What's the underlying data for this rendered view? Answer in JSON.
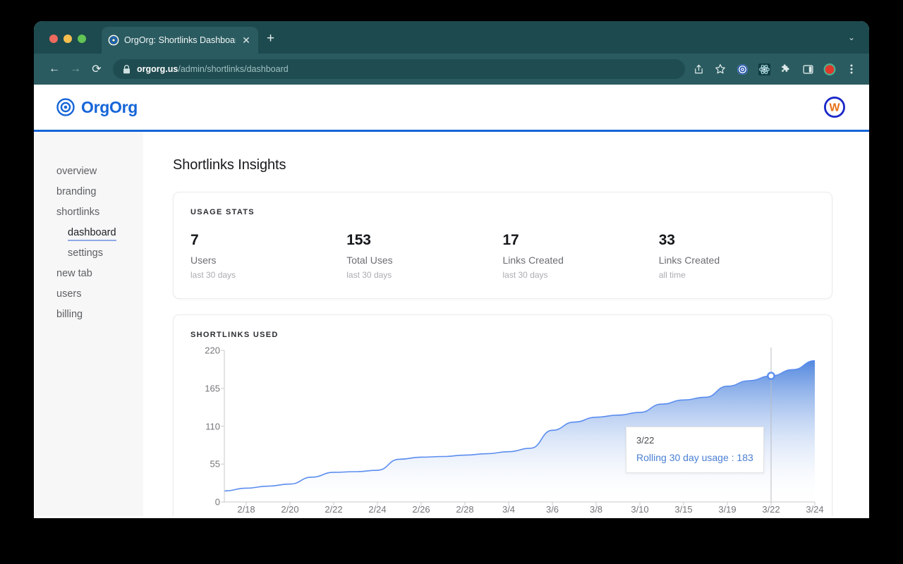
{
  "browser": {
    "tab": {
      "title": "OrgOrg: Shortlinks Dashboard",
      "favicon": "target-icon",
      "close": "✕"
    },
    "new_tab": "+",
    "window_chevron": "⌄",
    "nav": {
      "back": "←",
      "forward": "→",
      "reload": "⟳"
    },
    "omnibox": {
      "domain": "orgorg.us",
      "path": "/admin/shortlinks/dashboard",
      "lock": "lock-icon"
    },
    "actions": [
      "share-icon",
      "bookmark-star-icon",
      "target-extension-icon",
      "atom-extension-icon",
      "puzzle-extension-icon",
      "side-panel-icon",
      "profile-avatar-icon",
      "three-dot-menu-icon"
    ]
  },
  "app": {
    "brand": {
      "name": "OrgOrg",
      "mark": "target-logo-icon"
    },
    "avatar_letter": "W"
  },
  "sidebar": {
    "items": [
      {
        "label": "overview",
        "sub": false,
        "active": false
      },
      {
        "label": "branding",
        "sub": false,
        "active": false
      },
      {
        "label": "shortlinks",
        "sub": false,
        "active": false
      },
      {
        "label": "dashboard",
        "sub": true,
        "active": true
      },
      {
        "label": "settings",
        "sub": true,
        "active": false
      },
      {
        "label": "new tab",
        "sub": false,
        "active": false
      },
      {
        "label": "users",
        "sub": false,
        "active": false
      },
      {
        "label": "billing",
        "sub": false,
        "active": false
      }
    ]
  },
  "main": {
    "page_title": "Shortlinks Insights",
    "stats_card": {
      "label": "USAGE STATS",
      "stats": [
        {
          "value": "7",
          "name": "Users",
          "period": "last 30 days"
        },
        {
          "value": "153",
          "name": "Total Uses",
          "period": "last 30 days"
        },
        {
          "value": "17",
          "name": "Links Created",
          "period": "last 30 days"
        },
        {
          "value": "33",
          "name": "Links Created",
          "period": "all time"
        }
      ]
    },
    "chart_card": {
      "label": "SHORTLINKS USED",
      "tooltip": {
        "date": "3/22",
        "value": "Rolling 30 day usage : 183"
      }
    }
  },
  "chart_data": {
    "type": "area",
    "title": "SHORTLINKS USED",
    "xlabel": "",
    "ylabel": "",
    "ylim": [
      0,
      220
    ],
    "yticks": [
      0,
      55,
      110,
      165,
      220
    ],
    "grid": false,
    "legend": false,
    "series_name": "Rolling 30 day usage",
    "line_color": "#5b8def",
    "fill_gradient": [
      "#4a82dd",
      "#ffffff"
    ],
    "hover": {
      "x": "3/22",
      "y": 183
    },
    "categories": [
      "2/18",
      "2/20",
      "2/22",
      "2/24",
      "2/26",
      "2/28",
      "3/4",
      "3/6",
      "3/8",
      "3/10",
      "3/15",
      "3/19",
      "3/22",
      "3/24"
    ],
    "x": [
      "2/17",
      "2/18",
      "2/19",
      "2/20",
      "2/21",
      "2/22",
      "2/23",
      "2/24",
      "2/25",
      "2/26",
      "2/27",
      "2/28",
      "3/3",
      "3/4",
      "3/5",
      "3/6",
      "3/7",
      "3/8",
      "3/9",
      "3/10",
      "3/14",
      "3/15",
      "3/18",
      "3/19",
      "3/21",
      "3/22",
      "3/23",
      "3/24"
    ],
    "values": [
      16,
      20,
      23,
      26,
      36,
      43,
      44,
      46,
      62,
      65,
      66,
      68,
      70,
      73,
      78,
      104,
      116,
      123,
      126,
      130,
      142,
      148,
      152,
      168,
      176,
      183,
      192,
      205
    ]
  }
}
